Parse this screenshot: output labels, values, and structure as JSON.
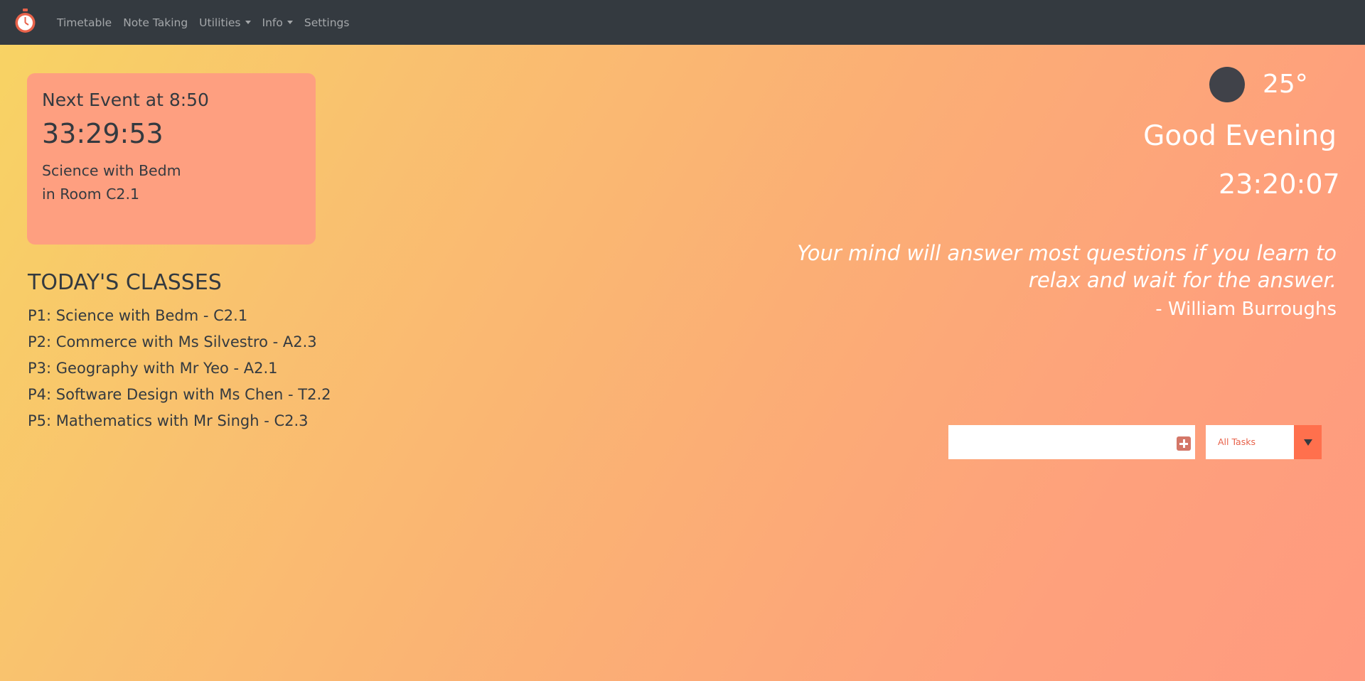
{
  "nav": {
    "logo_icon": "stopwatch-icon",
    "items": [
      {
        "label": "Timetable",
        "dropdown": false
      },
      {
        "label": "Note Taking",
        "dropdown": false
      },
      {
        "label": "Utilities",
        "dropdown": true
      },
      {
        "label": "Info",
        "dropdown": true
      },
      {
        "label": "Settings",
        "dropdown": false
      }
    ]
  },
  "next_event": {
    "heading": "Next Event at 8:50",
    "countdown": "33:29:53",
    "subject_line": "Science with Bedm",
    "room_line": "in Room C2.1"
  },
  "classes": {
    "title": "TODAY'S CLASSES",
    "items": [
      "P1: Science with Bedm - C2.1",
      "P2: Commerce with Ms Silvestro - A2.3",
      "P3: Geography with Mr Yeo - A2.1",
      "P4: Software Design with Ms Chen - T2.2",
      "P5: Mathematics with Mr Singh - C2.3"
    ]
  },
  "weather": {
    "icon": "weather-icon",
    "temperature": "25°"
  },
  "greeting": "Good Evening",
  "clock": "23:20:07",
  "quote": {
    "text": "Your mind will answer most questions if you learn to relax and wait for the answer.",
    "author": "- William Burroughs"
  },
  "tasks": {
    "input_value": "",
    "add_icon": "plus-icon",
    "filter_selected": "All Tasks"
  },
  "colors": {
    "navbar": "#343a40",
    "card": "#fe9f80",
    "accent": "#ff704d",
    "gradient_start": "#f8d463",
    "gradient_end": "#ff9a7f"
  }
}
